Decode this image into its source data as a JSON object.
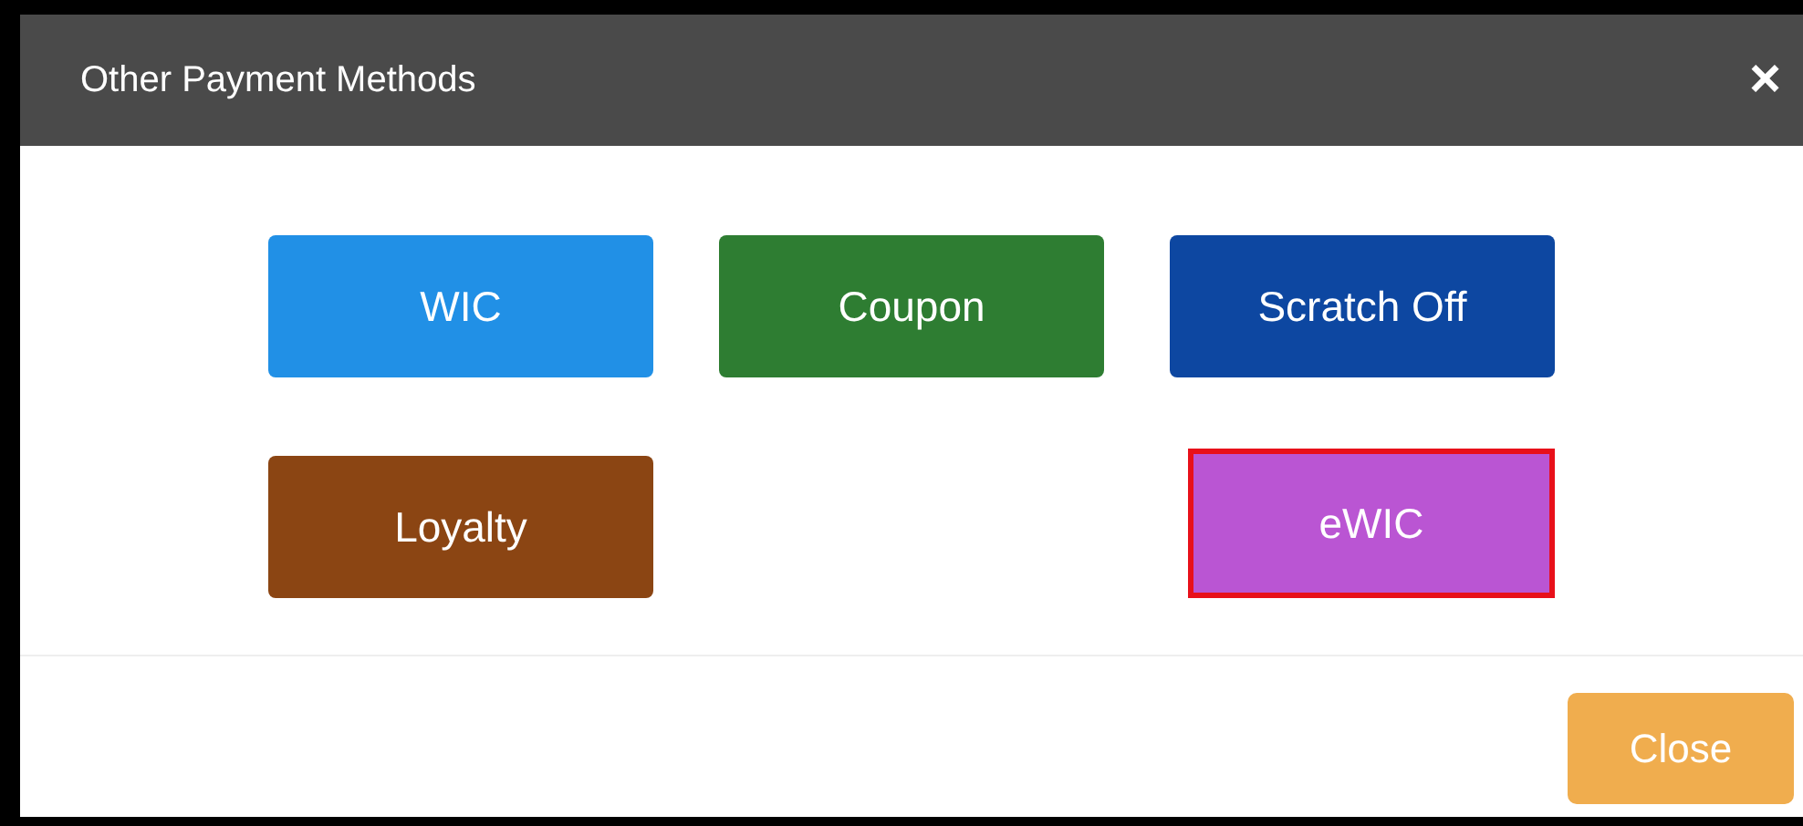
{
  "dialog": {
    "title": "Other Payment Methods",
    "close_glyph": "×"
  },
  "methods": [
    {
      "label": "WIC",
      "color": "#2190e6",
      "selected": false
    },
    {
      "label": "Coupon",
      "color": "#2e7d32",
      "selected": false
    },
    {
      "label": "Scratch Off",
      "color": "#0d47a1",
      "selected": false
    },
    {
      "label": "Loyalty",
      "color": "#8b4513",
      "selected": false
    },
    {
      "label": "eWIC",
      "color": "#ba55d3",
      "selected": true
    }
  ],
  "footer": {
    "close_label": "Close"
  }
}
